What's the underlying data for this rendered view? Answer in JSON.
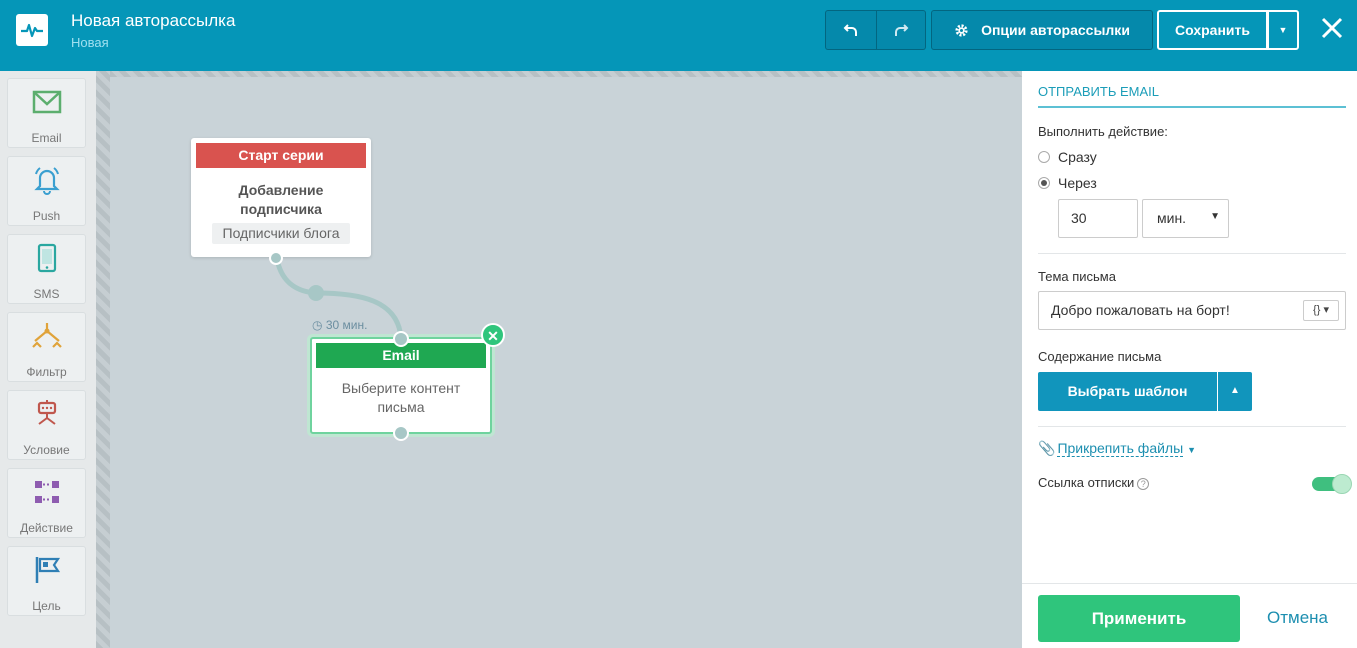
{
  "header": {
    "title": "Новая авторассылка",
    "subtitle": "Новая",
    "options_label": "Опции авторассылки",
    "save_label": "Сохранить"
  },
  "toolbar": {
    "items": [
      {
        "label": "Email",
        "icon": "envelope-icon",
        "color": "#5cae6e"
      },
      {
        "label": "Push",
        "icon": "bell-icon",
        "color": "#3a9fd0"
      },
      {
        "label": "SMS",
        "icon": "phone-icon",
        "color": "#2aa7a0"
      },
      {
        "label": "Фильтр",
        "icon": "filter-icon",
        "color": "#e0a33a"
      },
      {
        "label": "Условие",
        "icon": "condition-icon",
        "color": "#c0574d"
      },
      {
        "label": "Действие",
        "icon": "action-icon",
        "color": "#8e5cb0"
      },
      {
        "label": "Цель",
        "icon": "flag-icon",
        "color": "#2f7fb5"
      }
    ]
  },
  "canvas": {
    "start_node": {
      "header": "Старт серии",
      "title_line1": "Добавление",
      "title_line2": "подписчика",
      "tag": "Подписчики блога"
    },
    "delay_label": "30 мин.",
    "email_node": {
      "header": "Email",
      "text_line1": "Выберите контент",
      "text_line2": "письма"
    }
  },
  "panel": {
    "title": "ОТПРАВИТЬ EMAIL",
    "action_label": "Выполнить действие:",
    "option_now": "Сразу",
    "option_after": "Через",
    "selected_option": "Через",
    "delay_value": "30",
    "delay_unit": "мин.",
    "subject_label": "Тема письма",
    "subject_value": "Добро пожаловать на борт!",
    "var_button": "{}",
    "content_label": "Содержание письма",
    "choose_template": "Выбрать шаблон",
    "attach_files": "Прикрепить файлы",
    "unsubscribe_label": "Ссылка отписки",
    "unsubscribe_enabled": true,
    "apply_label": "Применить",
    "cancel_label": "Отмена"
  },
  "colors": {
    "header_bg": "#0596b8",
    "start_header": "#d9534f",
    "email_header": "#1fa852",
    "accent_green": "#2fc57c",
    "primary_blue": "#1195bc"
  }
}
